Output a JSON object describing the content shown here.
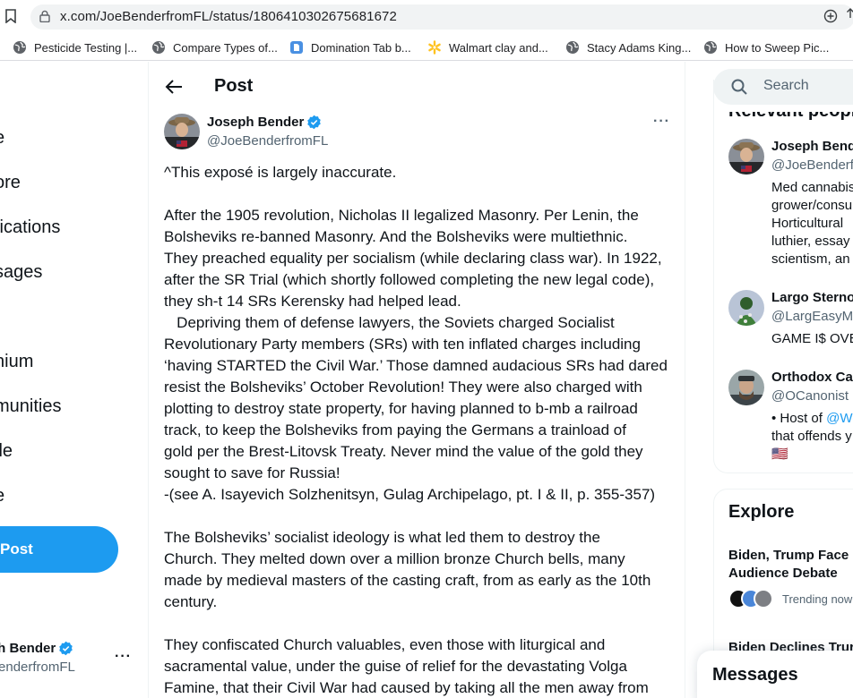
{
  "browser": {
    "url_host": "x.com",
    "url_path": "/JoeBenderfromFL/status/1806410302675681672",
    "bookmarks": [
      {
        "label": "Pesticide Testing |...",
        "icon": "globe-icon"
      },
      {
        "label": "Compare Types of...",
        "icon": "globe-icon"
      },
      {
        "label": "Domination Tab b...",
        "icon": "doc-icon"
      },
      {
        "label": "Walmart clay and...",
        "icon": "walmart-spark-icon"
      },
      {
        "label": "Stacy Adams King...",
        "icon": "globe-icon"
      },
      {
        "label": "How to Sweep Pic...",
        "icon": "globe-icon"
      }
    ]
  },
  "nav": {
    "items": [
      "e",
      "ore",
      "fications",
      "sages",
      "t",
      "nium",
      "munities",
      "ile",
      "e"
    ],
    "post_label": "Post",
    "account_name": "ph Bender",
    "account_handle": "BenderfromFL",
    "more_label": "···"
  },
  "main": {
    "header_title": "Post",
    "author_name": "Joseph Bender",
    "author_handle": "@JoeBenderfromFL",
    "more_label": "···",
    "paragraphs": [
      "^This exposé is largely inaccurate.",
      "After the 1905 revolution, Nicholas II legalized Masonry. Per Lenin, the\nBolsheviks re-banned Masonry. And the Bolsheviks were multiethnic.\nThey preached equality per socialism (while declaring class war). In 1922,\nafter the SR Trial (which shortly followed completing the new legal code),\nthey sh-t 14 SRs Kerensky had helped lead.\n   Depriving them of defense lawyers, the Soviets charged Socialist\nRevolutionary Party members (SRs) with ten inflated charges including\n‘having STARTED the Civil War.’ Those damned audacious SRs had dared\nresist the Bolsheviks’ October Revolution! They were also charged with\nplotting to destroy state property, for having planned to b-mb a railroad\ntrack, to keep the Bolsheviks from paying the Germans a trainload of\ngold per the Brest-Litovsk Treaty. Never mind the value of the gold they\nsought to save for Russia!\n-(see A. Isayevich Solzhenitsyn, Gulag Archipelago, pt. I & II, p. 355-357)",
      "The Bolsheviks’ socialist ideology is what led them to destroy the\nChurch. They melted down over a million bronze Church bells, many\nmade by medieval masters of the casting craft, from as early as the 10th\ncentury.",
      "They confiscated Church valuables, even those with liturgical and\nsacramental value, under the guise of relief for the devastating Volga\nFamine, that their Civil War had caused by taking all the men away from"
    ]
  },
  "right": {
    "search_placeholder": "Search",
    "relevant_title": "Relevant people",
    "people": [
      {
        "name": "Joseph Bend",
        "handle": "@JoeBenderf",
        "bio": [
          "Med cannabis",
          "grower/consu",
          "Horticultural",
          "luthier, essay",
          "scientism, an"
        ]
      },
      {
        "name": "Largo Sterno",
        "handle": "@LargEasyMo",
        "bio": [
          "GAME I$ OVE"
        ]
      },
      {
        "name": "Orthodox Ca",
        "handle": "@OCanonist",
        "bio_prefix": "• Host of ",
        "bio_link": "@We",
        "bio_line2": "that offends y",
        "bio_flag": "🇺🇸"
      }
    ],
    "explore_title": "Explore",
    "trends": [
      {
        "title": "Biden, Trump Face O",
        "title_line2": "Audience Debate",
        "meta": "Trending now"
      },
      {
        "title": "Biden Declines Trur"
      }
    ],
    "messages_title": "Messages"
  }
}
